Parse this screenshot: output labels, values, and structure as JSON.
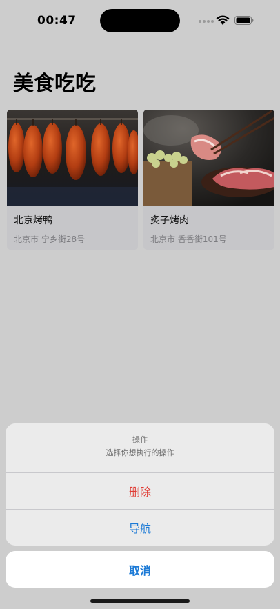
{
  "status_bar": {
    "time": "00:47"
  },
  "header": {
    "title": "美食吃吃"
  },
  "restaurants": [
    {
      "name": "北京烤鸭",
      "address": "北京市 宁乡街28号",
      "image": "roast-duck-photo"
    },
    {
      "name": "炙子烤肉",
      "address": "北京市 香香街101号",
      "image": "grilled-meat-photo"
    }
  ],
  "action_sheet": {
    "title": "操作",
    "message": "选择你想执行的操作",
    "delete_label": "删除",
    "navigate_label": "导航",
    "cancel_label": "取消"
  },
  "colors": {
    "destructive": "#e03a32",
    "accent": "#1c7ad6"
  }
}
